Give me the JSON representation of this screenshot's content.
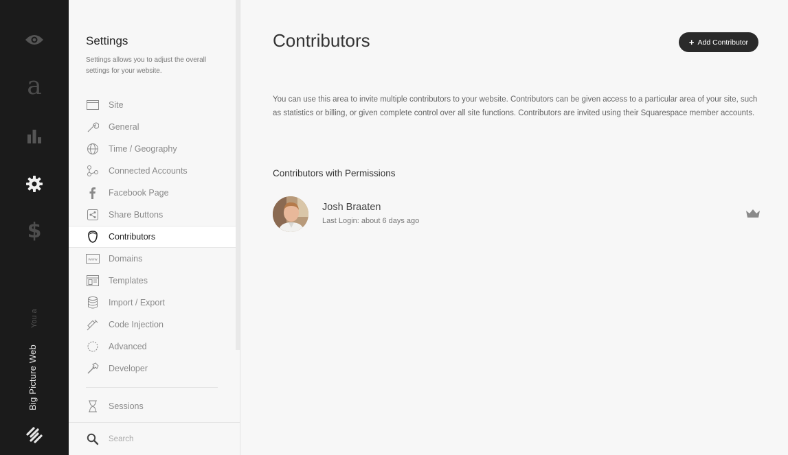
{
  "rail": {
    "icons": [
      "eye-icon",
      "typography-icon",
      "analytics-icon",
      "gear-icon",
      "dollar-icon"
    ],
    "font_glyph": "a",
    "dollar_glyph": "$",
    "site_name": "Big Picture Web",
    "you_label": "You a"
  },
  "settings": {
    "title": "Settings",
    "description": "Settings allows you to adjust the overall settings for your website.",
    "items": [
      {
        "label": "Site",
        "icon": "site-icon"
      },
      {
        "label": "General",
        "icon": "wrench-icon"
      },
      {
        "label": "Time / Geography",
        "icon": "globe-icon"
      },
      {
        "label": "Connected Accounts",
        "icon": "connected-icon"
      },
      {
        "label": "Facebook Page",
        "icon": "facebook-icon"
      },
      {
        "label": "Share Buttons",
        "icon": "share-icon"
      },
      {
        "label": "Contributors",
        "icon": "contributor-icon",
        "active": true
      },
      {
        "label": "Domains",
        "icon": "www-icon"
      },
      {
        "label": "Templates",
        "icon": "template-icon"
      },
      {
        "label": "Import / Export",
        "icon": "database-icon"
      },
      {
        "label": "Code Injection",
        "icon": "syringe-icon"
      },
      {
        "label": "Advanced",
        "icon": "advanced-icon"
      },
      {
        "label": "Developer",
        "icon": "hammer-icon"
      }
    ],
    "secondary_items": [
      {
        "label": "Sessions",
        "icon": "hourglass-icon"
      }
    ],
    "search_placeholder": "Search"
  },
  "main": {
    "title": "Contributors",
    "add_button_plus": "+",
    "add_button_label": "Add Contributor",
    "intro": "You can use this area to invite multiple contributors to your website. Contributors can be given access to a particular area of your site, such as statistics or billing, or given complete control over all site functions. Contributors are invited using their Squarespace member accounts.",
    "section_title": "Contributors with Permissions",
    "contributors": [
      {
        "name": "Josh Braaten",
        "last_login": "Last Login: about 6 days ago",
        "role_icon": "crown-icon"
      }
    ]
  },
  "colors": {
    "rail_bg": "#1b1b1b",
    "panel_bg": "#f7f7f7",
    "button_bg": "#2a2a2a"
  }
}
